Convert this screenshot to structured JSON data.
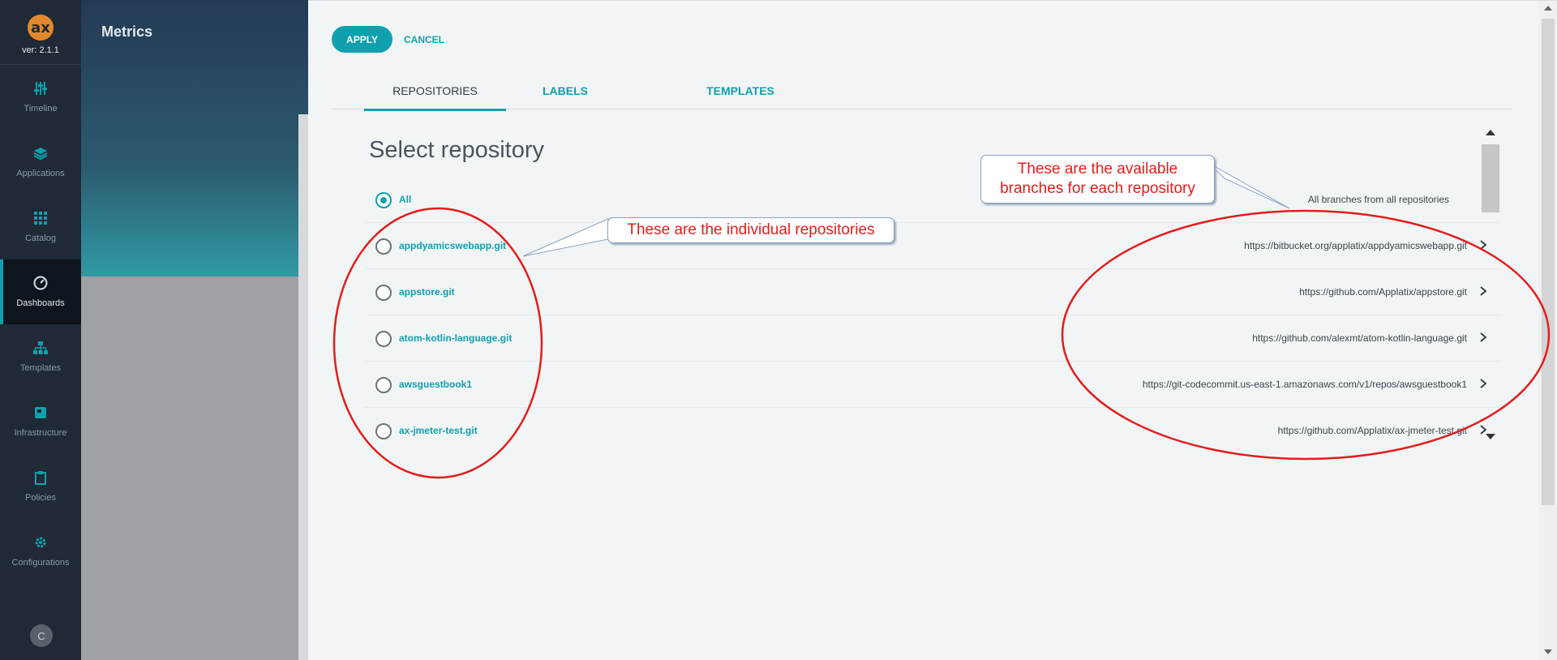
{
  "app": {
    "version": "ver: 2.1.1",
    "logo_text": "ax"
  },
  "nav": {
    "items": [
      {
        "label": "Timeline",
        "icon": "sliders-icon"
      },
      {
        "label": "Applications",
        "icon": "layers-icon"
      },
      {
        "label": "Catalog",
        "icon": "grid-icon"
      },
      {
        "label": "Dashboards",
        "icon": "gauge-icon",
        "active": true
      },
      {
        "label": "Templates",
        "icon": "hierarchy-icon"
      },
      {
        "label": "Infrastructure",
        "icon": "server-icon"
      },
      {
        "label": "Policies",
        "icon": "clipboard-icon"
      },
      {
        "label": "Configurations",
        "icon": "gear-icon"
      }
    ],
    "avatar": "C"
  },
  "background": {
    "title": "Metrics"
  },
  "panel": {
    "apply_label": "APPLY",
    "cancel_label": "CANCEL",
    "tabs": [
      "REPOSITORIES",
      "LABELS",
      "TEMPLATES"
    ],
    "active_tab": "REPOSITORIES",
    "heading": "Select repository",
    "all_label": "All",
    "all_caption": "All branches from all repositories",
    "repositories": [
      {
        "name": "appdyamicswebapp.git",
        "url": "https://bitbucket.org/applatix/appdyamicswebapp.git"
      },
      {
        "name": "appstore.git",
        "url": "https://github.com/Applatix/appstore.git"
      },
      {
        "name": "atom-kotlin-language.git",
        "url": "https://github.com/alexmt/atom-kotlin-language.git"
      },
      {
        "name": "awsguestbook1",
        "url": "https://git-codecommit.us-east-1.amazonaws.com/v1/repos/awsguestbook1"
      },
      {
        "name": "ax-jmeter-test.git",
        "url": "https://github.com/Applatix/ax-jmeter-test.git"
      }
    ]
  },
  "annotations": {
    "repos_note": "These are the individual repositories",
    "branches_note_line1": "These are the available",
    "branches_note_line2": "branches for each repository"
  },
  "colors": {
    "accent": "#10a0ad",
    "annotation": "#e51c1c",
    "nav_bg": "#1f2a36"
  }
}
